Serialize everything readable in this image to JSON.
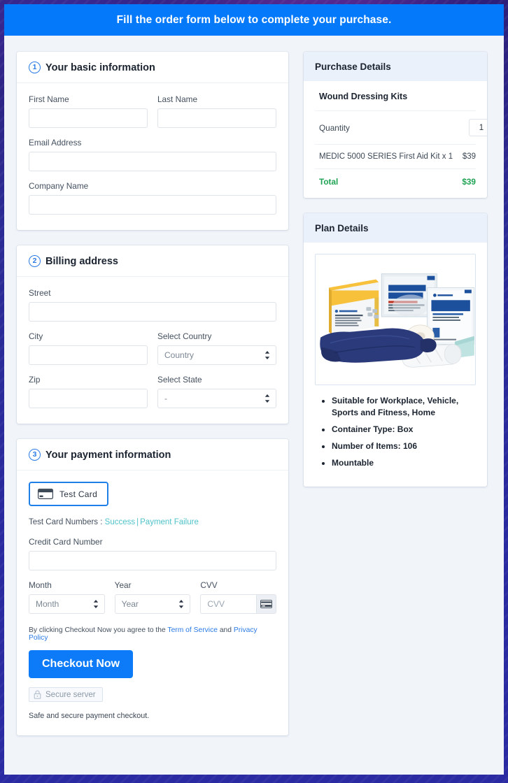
{
  "banner": {
    "text": "Fill the order form below to complete your purchase."
  },
  "sections": {
    "basic": {
      "step": "1",
      "title": "Your basic information",
      "fields": {
        "first_name_label": "First Name",
        "first_name_value": "",
        "last_name_label": "Last Name",
        "last_name_value": "",
        "email_label": "Email Address",
        "email_value": "",
        "company_label": "Company Name",
        "company_value": ""
      }
    },
    "billing": {
      "step": "2",
      "title": "Billing address",
      "fields": {
        "street_label": "Street",
        "street_value": "",
        "city_label": "City",
        "city_value": "",
        "country_label": "Select Country",
        "country_value": "Country",
        "zip_label": "Zip",
        "zip_value": "",
        "state_label": "Select State",
        "state_value": "-"
      }
    },
    "payment": {
      "step": "3",
      "title": "Your payment information",
      "card_type_label": "Test  Card",
      "test_numbers_prefix": "Test Card Numbers : ",
      "test_success_link": "Success",
      "test_separator": "|",
      "test_failure_link": "Payment Failure",
      "card_number_label": "Credit Card Number",
      "card_number_value": "",
      "month_label": "Month",
      "month_value": "Month",
      "year_label": "Year",
      "year_value": "Year",
      "cvv_label": "CVV",
      "cvv_placeholder": "CVV",
      "terms_prefix": "By clicking Checkout Now you agree to the ",
      "terms_link": "Term of Service",
      "terms_and": " and ",
      "privacy_link": "Privacy Policy",
      "checkout_label": "Checkout Now",
      "secure_badge": "Secure server",
      "safe_note": "Safe and secure payment checkout."
    }
  },
  "purchase_details": {
    "title": "Purchase Details",
    "product_name": "Wound Dressing Kits",
    "quantity_label": "Quantity",
    "quantity_value": "1",
    "line_item_label": "MEDIC 5000 SERIES First Aid Kit x 1",
    "line_item_price": "$39",
    "total_label": "Total",
    "total_price": "$39"
  },
  "plan_details": {
    "title": "Plan Details",
    "image_alt": "first-aid-kit-contents-image",
    "bullets": [
      "Suitable for Workplace, Vehicle, Sports and Fitness, Home",
      "Container Type: Box",
      "Number of Items: 106",
      "Mountable"
    ]
  },
  "colors": {
    "accent_blue": "#047afb",
    "link_blue": "#2a7ae4",
    "teal_link": "#4fc3c9",
    "total_green": "#1fa354",
    "panel_head_bg": "#eaf1fb"
  }
}
